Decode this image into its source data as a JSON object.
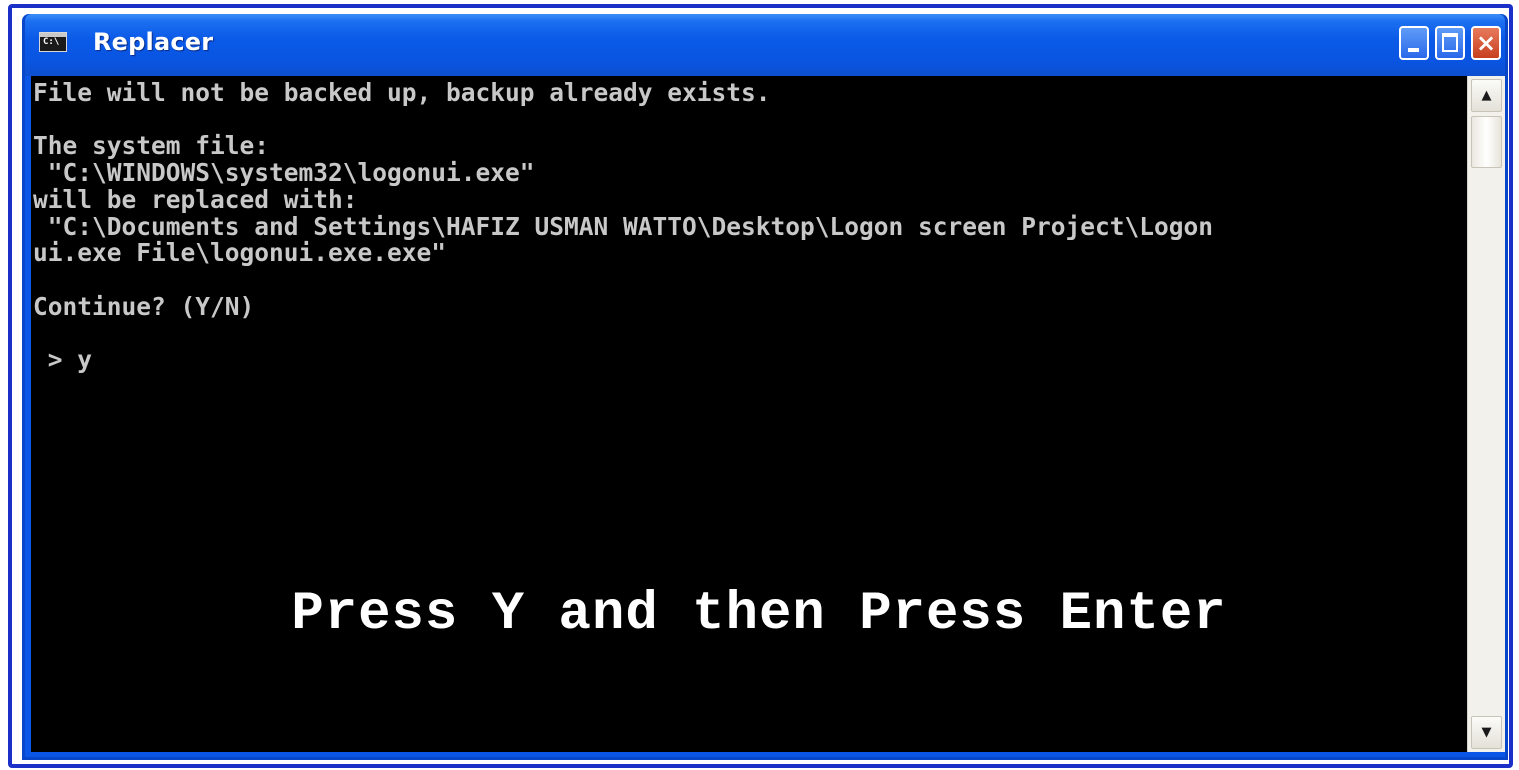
{
  "window": {
    "title": "Replacer",
    "icon": "console-icon",
    "icon_label": "C:\\",
    "controls": {
      "minimize": "minimize-icon",
      "maximize": "maximize-icon",
      "close": "close-icon",
      "close_glyph": "×"
    }
  },
  "console": {
    "lines": [
      "File will not be backed up, backup already exists.",
      "",
      "The system file:",
      " \"C:\\WINDOWS\\system32\\logonui.exe\"",
      "will be replaced with:",
      " \"C:\\Documents and Settings\\HAFIZ USMAN WATTO\\Desktop\\Logon screen Project\\Logon",
      "ui.exe File\\logonui.exe.exe\"",
      "",
      "Continue? (Y/N)",
      "",
      " > y"
    ],
    "overlay_caption": "Press Y and then Press Enter"
  },
  "scrollbar": {
    "up_arrow": "▲",
    "down_arrow": "▼"
  },
  "colors": {
    "frame_border": "#1b2fc9",
    "titlebar": "#0a55e2",
    "console_bg": "#000000",
    "console_text": "#c8c8c8",
    "caption_text": "#ffffff"
  }
}
